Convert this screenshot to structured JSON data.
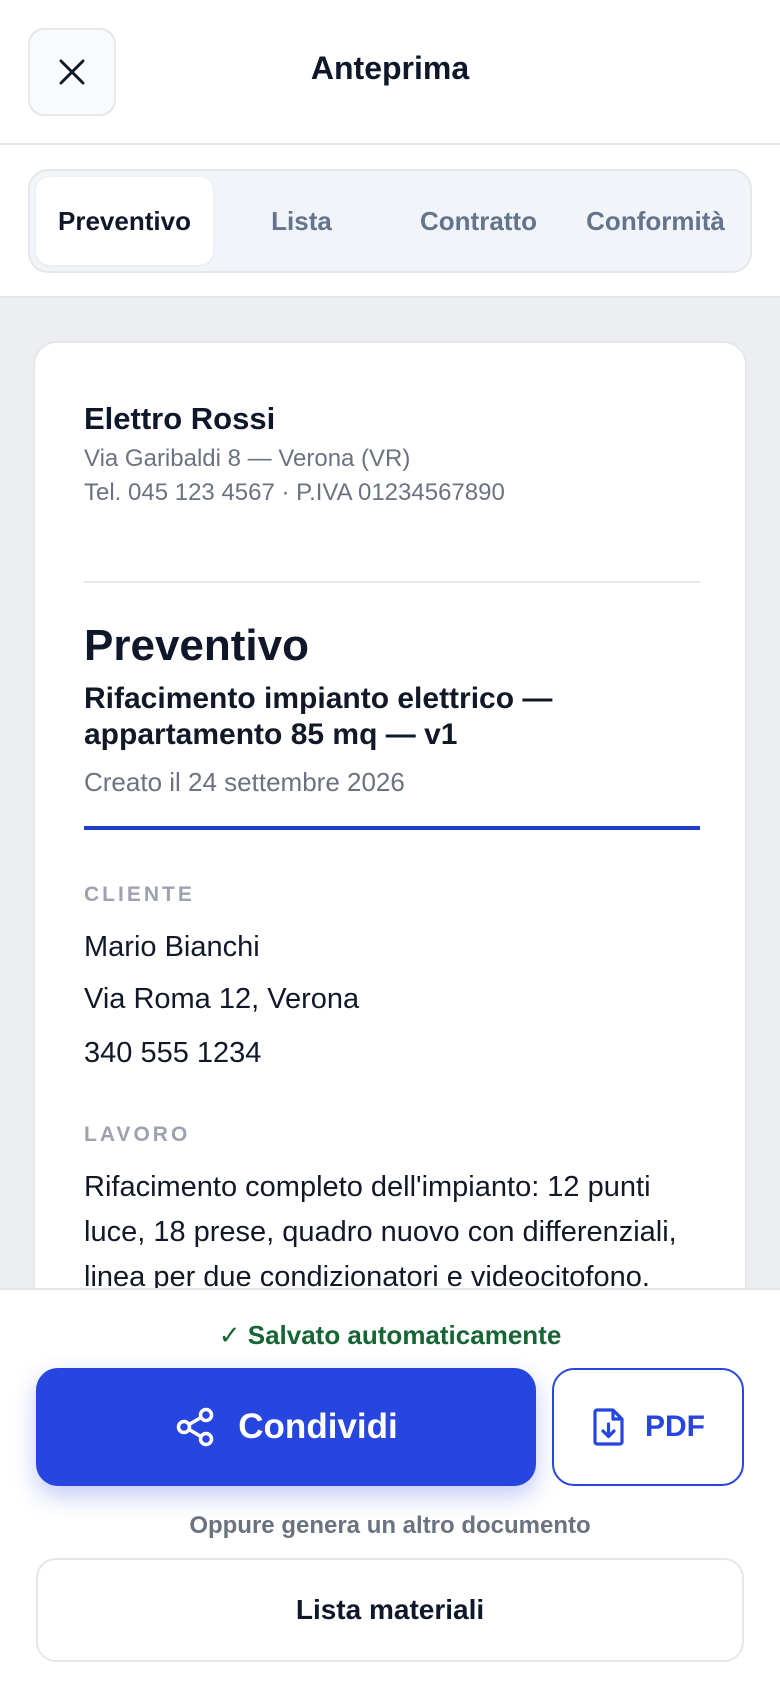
{
  "header": {
    "title": "Anteprima"
  },
  "tabs": [
    {
      "label": "Preventivo",
      "active": true
    },
    {
      "label": "Lista",
      "active": false
    },
    {
      "label": "Contratto",
      "active": false
    },
    {
      "label": "Conformità",
      "active": false
    }
  ],
  "document": {
    "company": {
      "name": "Elettro Rossi",
      "address": "Via Garibaldi 8 — Verona (VR)",
      "contact": "Tel. 045 123 4567 · P.IVA 01234567890"
    },
    "title": "Preventivo",
    "subtitle": "Rifacimento impianto elettrico — appartamento 85 mq — v1",
    "created": "Creato il 24 settembre 2026",
    "client_label": "CLIENTE",
    "client": {
      "name": "Mario Bianchi",
      "address": "Via Roma 12, Verona",
      "phone": "340 555 1234"
    },
    "work_label": "LAVORO",
    "work_description": "Rifacimento completo dell'impianto: 12 punti luce, 18 prese, quadro nuovo con differenziali, linea per due condizionatori e videocitofono."
  },
  "footer": {
    "saved_status": "✓ Salvato automaticamente",
    "share_label": "Condividi",
    "pdf_label": "PDF",
    "alt_text": "Oppure genera un altro documento",
    "materials_label": "Lista materiali"
  },
  "colors": {
    "accent": "#2746e0",
    "saved_green": "#166534",
    "content_bg": "#eceef1"
  },
  "icons": [
    "close-icon",
    "share-icon",
    "file-download-icon"
  ]
}
